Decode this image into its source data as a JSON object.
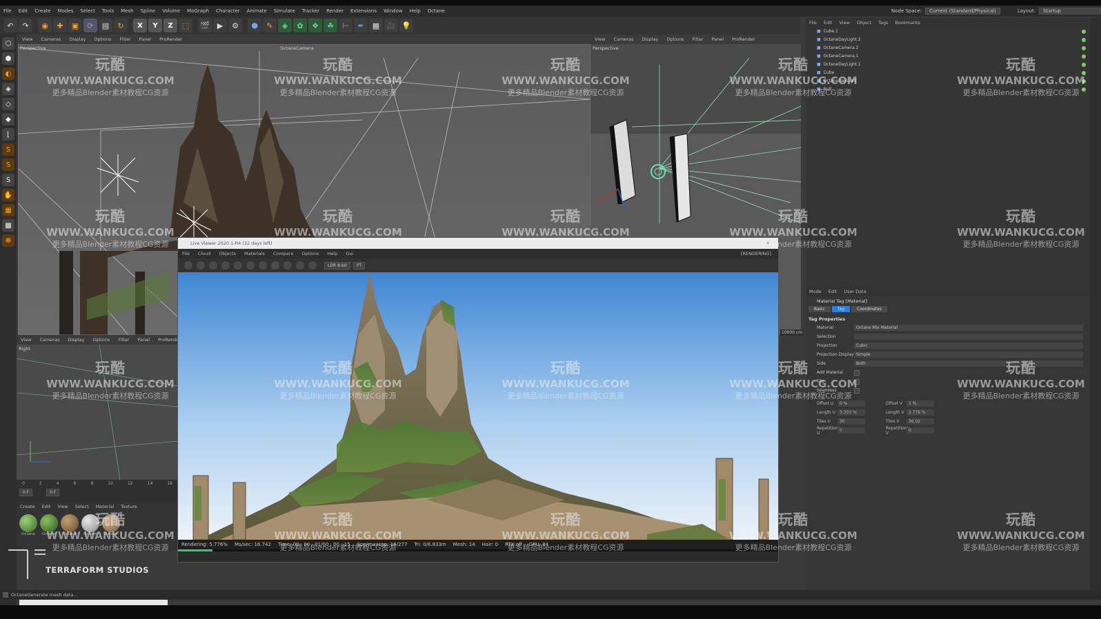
{
  "menu": [
    "File",
    "Edit",
    "Create",
    "Modes",
    "Select",
    "Tools",
    "Mesh",
    "Spline",
    "Volume",
    "MoGraph",
    "Character",
    "Animate",
    "Simulate",
    "Tracker",
    "Render",
    "Extensions",
    "Window",
    "Help",
    "Octane"
  ],
  "node_space_label": "Node Space:",
  "node_space_value": "Current (Standard/Physical)",
  "layout_label": "Layout:",
  "layout_value": "Startup",
  "toolbar_axes": [
    "X",
    "Y",
    "Z"
  ],
  "viewport_menu": [
    "View",
    "Cameras",
    "Display",
    "Options",
    "Filter",
    "Panel",
    "ProRender"
  ],
  "vp_main_label": "Perspective",
  "vp_main_camera": "OctaneCamera",
  "vp_right_label": "Perspective",
  "vp_bottom_label": "Right",
  "object_manager": {
    "menu": [
      "File",
      "Edit",
      "View",
      "Object",
      "Tags",
      "Bookmarks"
    ],
    "objects": [
      "Cube.1",
      "OctaneDayLight.2",
      "OctaneCamera.2",
      "OctaneCamera.1",
      "OctaneDayLight.1",
      "Cube",
      "OctaneDayLight",
      "Null"
    ]
  },
  "attributes": {
    "menu": [
      "Mode",
      "Edit",
      "User Data"
    ],
    "title": "Material Tag [Material]",
    "tabs": [
      "Basic",
      "Tag",
      "Coordinates"
    ],
    "section": "Tag Properties",
    "rows": [
      {
        "label": "Material",
        "value": "Octane Mix Material"
      },
      {
        "label": "Selection",
        "value": ""
      },
      {
        "label": "Projection",
        "value": "Cubic"
      },
      {
        "label": "Projection Display",
        "value": "Simple"
      },
      {
        "label": "Side",
        "value": "Both"
      }
    ],
    "checks": [
      "Add Material",
      "Tile",
      "Seamless"
    ],
    "grid": [
      {
        "l1": "Offset U",
        "v1": "0 %",
        "l2": "Offset V",
        "v2": "1 %"
      },
      {
        "l1": "Length U",
        "v1": "3.333 %",
        "l2": "Length V",
        "v2": "2.776 %"
      },
      {
        "l1": "Tiles U",
        "v1": "30",
        "l2": "Tiles V",
        "v2": "36.02"
      },
      {
        "l1": "Repetitions U",
        "v1": "0",
        "l2": "Repetitions V",
        "v2": "0"
      }
    ]
  },
  "timeline": {
    "ticks": [
      "0",
      "2",
      "4",
      "6",
      "8",
      "10",
      "12",
      "14",
      "16"
    ],
    "start": "0 F",
    "end": "0 F"
  },
  "material_manager": {
    "menu": [
      "Create",
      "Edit",
      "View",
      "Select",
      "Material",
      "Texture"
    ],
    "materials": [
      "Octane",
      "Octane",
      "Octane",
      "Octane",
      "Octane"
    ]
  },
  "live_viewer": {
    "title": "Live Viewer 2020.1-R4 (32 days left)",
    "menu": [
      "File",
      "Cloud",
      "Objects",
      "Materials",
      "Compare",
      "Options",
      "Help",
      "Gui"
    ],
    "status_right": "[RENDERING]",
    "dropdowns": [
      "LDR 8-bit",
      "PT"
    ],
    "status": [
      "Rendering: 5.776%",
      "Ms/sec: 16.742",
      "Time: 00 : 00 : 01/00 : 00 : 15",
      "Spp/maxspp: 16/277",
      "Tri: 0/6.833m",
      "Mesh: 14",
      "Hair: 0",
      "RTX:off",
      "GPU: 84"
    ],
    "progress": 0.05776
  },
  "dim_label": "10000 cm",
  "studio": "TERRAFORM STUDIOS",
  "status_bar": "OctaneGenerate mesh data...",
  "watermark": {
    "l1": "玩酷",
    "l2": "WWW.WANKUCG.COM",
    "l3": "更多精品Blender素材教程CG资源"
  },
  "colors": {
    "sky_top": "#4c8fd6",
    "sky_bottom": "#e6eef6",
    "accent_blue": "#2f7fd8",
    "render_green": "#2ecc71"
  }
}
